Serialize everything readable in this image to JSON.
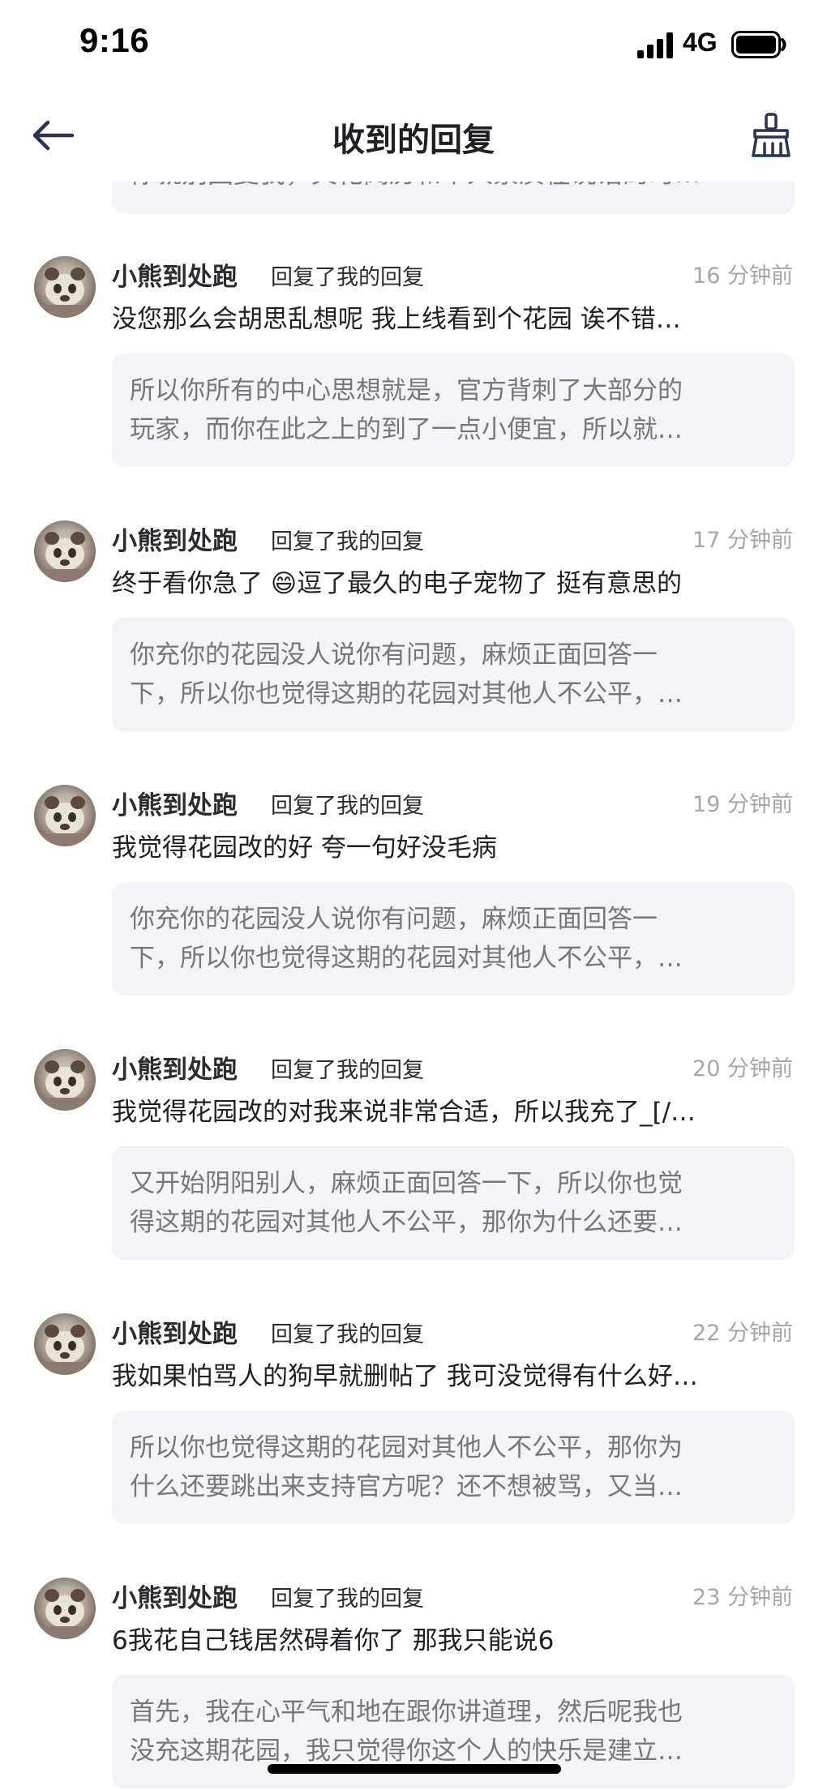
{
  "status_bar": {
    "time": "9:16",
    "network": "4G",
    "icons": [
      "signal-icon",
      "battery-icon"
    ]
  },
  "nav": {
    "title": "收到的回复",
    "back_icon": "arrow-left-icon",
    "clear_icon": "broom-icon"
  },
  "partial_quote": "你就别回复我，文化阅历和个人素质在说话的时…",
  "replies": [
    {
      "user": "小熊到处跑",
      "action": "回复了我的回复",
      "time": "16 分钟前",
      "text": "没您那么会胡思乱想呢  我上线看到个花园  诶不错…",
      "quote": [
        "所以你所有的中心思想就是，官方背刺了大部分的",
        "玩家，而你在此之上的到了一点小便宜，所以就…"
      ]
    },
    {
      "user": "小熊到处跑",
      "action": "回复了我的回复",
      "time": "17 分钟前",
      "text": "终于看你急了 😄逗了最久的电子宠物了  挺有意思的",
      "quote": [
        "你充你的花园没人说你有问题，麻烦正面回答一",
        "下，所以你也觉得这期的花园对其他人不公平，…"
      ]
    },
    {
      "user": "小熊到处跑",
      "action": "回复了我的回复",
      "time": "19 分钟前",
      "text": "我觉得花园改的好  夸一句好没毛病",
      "quote": [
        "你充你的花园没人说你有问题，麻烦正面回答一",
        "下，所以你也觉得这期的花园对其他人不公平，…"
      ]
    },
    {
      "user": "小熊到处跑",
      "action": "回复了我的回复",
      "time": "20 分钟前",
      "text": "我觉得花园改的对我来说非常合适，所以我充了_[/…",
      "quote": [
        "又开始阴阳别人，麻烦正面回答一下，所以你也觉",
        "得这期的花园对其他人不公平，那你为什么还要…"
      ]
    },
    {
      "user": "小熊到处跑",
      "action": "回复了我的回复",
      "time": "22 分钟前",
      "text": "我如果怕骂人的狗早就删帖了  我可没觉得有什么好…",
      "quote": [
        "所以你也觉得这期的花园对其他人不公平，那你为",
        "什么还要跳出来支持官方呢？还不想被骂，又当…"
      ]
    },
    {
      "user": "小熊到处跑",
      "action": "回复了我的回复",
      "time": "23 分钟前",
      "text": "6我花自己钱居然碍着你了  那我只能说6",
      "quote": [
        "首先，我在心平气和地在跟你讲道理，然后呢我也",
        "没充这期花园，我只觉得你这个人的快乐是建立…"
      ]
    }
  ]
}
